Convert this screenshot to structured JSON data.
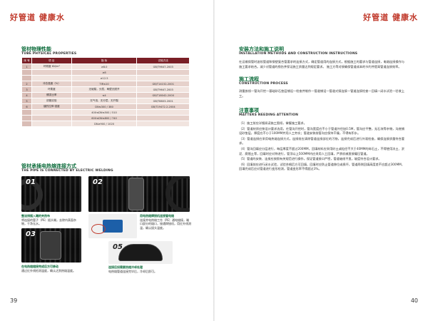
{
  "brand": {
    "left": "好管道  健康水",
    "right": "好管道  健康水"
  },
  "page_numbers": {
    "left": "39",
    "right": "40"
  },
  "left": {
    "physical": {
      "title": "管材物理性能",
      "subtitle": "TUBE PHYSICAL PROPERTIES",
      "headers": [
        "序  号",
        "项  目",
        "指  标",
        "试验方法"
      ],
      "rows": [
        {
          "idx": "1",
          "item": "环刚度\nKN/m²",
          "spec": "≥8.0",
          "method": "GB/T9647-2003"
        },
        {
          "idx": "",
          "item": "",
          "spec": "≥8",
          "method": ""
        },
        {
          "idx": "",
          "item": "",
          "spec": "≥12.5",
          "method": ""
        },
        {
          "idx": "2",
          "item": "冲击强度（%）",
          "spec": "TIR≤10",
          "method": "GB/T14152-2001"
        },
        {
          "idx": "3",
          "item": "环柔度",
          "spec": "无破裂，分层，两壁无脱开",
          "method": "GB/T9647-2003"
        },
        {
          "idx": "4",
          "item": "蠕变比率",
          "spec": "≤4",
          "method": "GB/T18042-2000"
        },
        {
          "idx": "5",
          "item": "烘箱实验",
          "spec": "无气泡，无分层，无开裂",
          "method": "GB/T8803-2001"
        },
        {
          "idx": "6",
          "item": "缝的拉伸\n强度",
          "spec": "DN≤300 / 380",
          "method": "GB/T19472.2-2004"
        },
        {
          "idx": "",
          "item": "",
          "spec": "400≤DN≤500 / 510",
          "method": ""
        },
        {
          "idx": "",
          "item": "",
          "spec": "600≤DN≤800 / 740",
          "method": ""
        },
        {
          "idx": "",
          "item": "",
          "spec": "DN≥900 / 1020",
          "method": ""
        }
      ]
    },
    "welding": {
      "title": "管材承插电热熔连接方式",
      "subtitle": "THE PIPE IS CONNECTED BY ELECTRIC WELDING",
      "steps": [
        {
          "num": "01",
          "title": "整洁排插入端的夹热布",
          "text": "将连接的管子（PE）插头端，去除内表面杂物，干净无水。"
        },
        {
          "num": "02",
          "title": "",
          "text": ""
        },
        {
          "num": "03",
          "title": "用电热熔焊接机连接管电熔",
          "text": "连接并电热熔工作（PE）通电熔接，端口部分的熔口，接通焊接机，用红外线测温，确认接头温度。"
        },
        {
          "num": "04",
          "title": "在电热熔熔接完成后方可移动",
          "text": "通过红外线检测温度，确认达到热熔温度。"
        },
        {
          "num": "05",
          "title": "连接后如需要热熔冷却处理",
          "text": "电热熔管道连接完毕后，冷却后即可。"
        }
      ]
    }
  },
  "right": {
    "install": {
      "title": "安装方法和施工说明",
      "subtitle": "INSTALLATION METHODS AND CONSTRUCTION INSTRUCTIONS",
      "text": "    在运输保管时波纹管道和钢塑复合管要求的连接方式，确定管道用的连接方式，根据施工的要求与管道连接，电熔连接操作与施工要求结合。减少对管道的损伤并保证施工质量达到规定要求。  施工方等对接确保管道成本的节约并提高管道连接效率。"
    },
    "process": {
      "title": "施工流程",
      "subtitle": "CONSTRUCTION PROCESS",
      "text": "测量放线一管沟开挖一基础砂石垫层铺设一检查井制作一管道铺设一管道对接连接一管道连接检查一回填一闭水试验一验收上工。"
    },
    "matters": {
      "title": "注意事项",
      "subtitle": "MATTERS NEEDING ATTENTION",
      "items": [
        "（1）施工前应详细阅读施工图纸，掌握施工要求。",
        "（2）管道材质应按设计要求选用，在管沟开挖时，管沟宽度应不小于管道外径加0.5M，管沟应平整，无石块等杂物，沟底铺设砂垫层，厚度应不小于100MM并用人工夯实；管道安装前管沟应保持干燥，不得有积水。",
        "（3）管道连接应采用电热熔连接方式，连接前应清除管道连接部位的污物，连接完成后进行外观检查，确保连接质量符合要求。",
        "（4）管沟回填应分层进行，每层厚度不超过200MM，回填材料应采用砂土或粒径不大于40MM的碎石土，不得使用冻土、淤泥、腐殖土等，回填时应对称进行，管顶以上500MM内应采用人工回填，严禁机械直接碾压管道。",
        "（5）管道的安装、连接应按照有关规范进行操作，保证管道接口严密，管道轴线平直，坡度符合设计要求。",
        "（6）回填前应进行闭水试验，试验合格后方可回填，回填时应防止管道移位或损坏，管道两侧回填高度差不应超过300MM，回填完成后应对管道进行变形检测，管道变形率不得超过3%。"
      ]
    }
  }
}
